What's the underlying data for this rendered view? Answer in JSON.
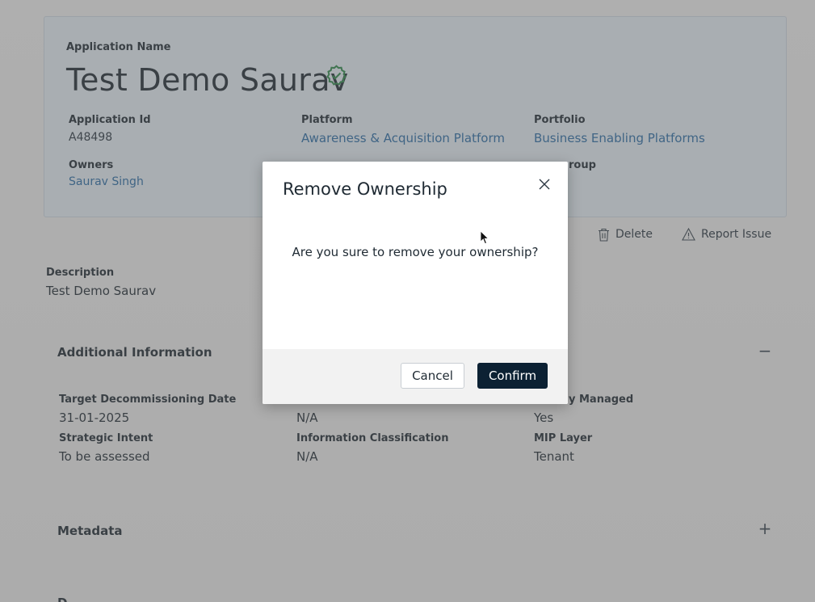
{
  "app": {
    "name_label": "Application Name",
    "name": "Test Demo Saurav",
    "verified_icon": "verified-badge-icon",
    "fields": {
      "app_id_label": "Application Id",
      "app_id": "A48498",
      "platform_label": "Platform",
      "platform": "Awareness & Acquisition Platform",
      "portfolio_label": "Portfolio",
      "portfolio": "Business Enabling Platforms",
      "owners_label": "Owners",
      "owners": "Saurav Singh",
      "group_label_partial": "roup"
    }
  },
  "actions": {
    "delete": "Delete",
    "report": "Report Issue"
  },
  "description": {
    "label": "Description",
    "value": "Test Demo Saurav"
  },
  "additional": {
    "title": "Additional Information",
    "target_label": "Target Decommissioning Date",
    "target_value": "31-01-2025",
    "col2_value": "N/A",
    "managed_label_partial": "y Managed",
    "managed_value": "Yes",
    "strategic_label": "Strategic Intent",
    "strategic_value": "To be assessed",
    "info_label": "Information Classification",
    "info_value": "N/A",
    "mip_label": "MIP Layer",
    "mip_value": "Tenant"
  },
  "metadata": {
    "title": "Metadata"
  },
  "next_section_partial": "D",
  "modal": {
    "title": "Remove Ownership",
    "message": "Are you sure to remove your ownership?",
    "cancel": "Cancel",
    "confirm": "Confirm"
  },
  "colors": {
    "link": "#2b6da8",
    "confirm_bg": "#0c2133",
    "card_bg": "#e9f2fa",
    "verified": "#2e8b4c"
  }
}
